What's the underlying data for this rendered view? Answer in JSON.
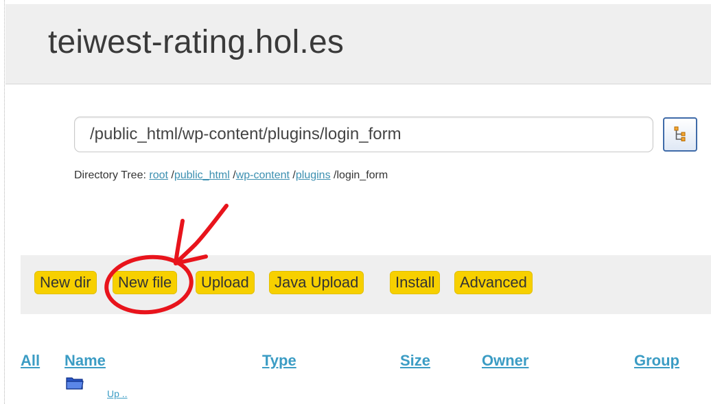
{
  "header": {
    "site_title": "teiwest-rating.hol.es"
  },
  "path_bar": {
    "value": "/public_html/wp-content/plugins/login_form",
    "tree_button_icon": "directory-tree-icon"
  },
  "directory_tree": {
    "label": "Directory Tree:",
    "crumbs": [
      "root",
      "public_html",
      "wp-content",
      "plugins"
    ],
    "separator": "/",
    "current": "login_form"
  },
  "toolbar": {
    "buttons": [
      "New dir",
      "New file",
      "Upload",
      "Java Upload",
      "Install",
      "Advanced"
    ]
  },
  "file_table": {
    "columns": [
      "All",
      "Name",
      "Type",
      "Size",
      "Owner",
      "Group"
    ],
    "rows": [
      {
        "icon": "folder-icon",
        "name": "Up .."
      }
    ]
  },
  "annotation": {
    "color": "#e8141c"
  }
}
